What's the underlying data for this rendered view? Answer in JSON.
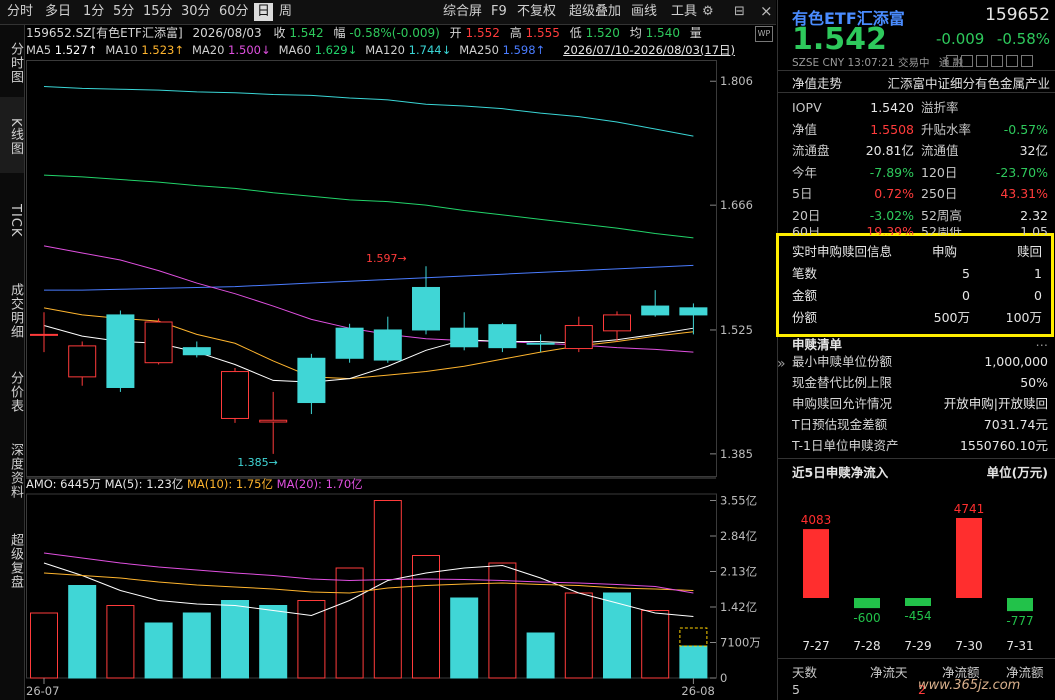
{
  "toolbar": {
    "left": [
      "分时",
      "多日",
      "1分",
      "5分",
      "15分",
      "30分",
      "60分",
      "日",
      "周"
    ],
    "active": "日",
    "right": [
      "综合屏",
      "F9",
      "不复权",
      "超级叠加",
      "画线",
      "工具"
    ]
  },
  "left_tabs": [
    "分时图",
    "K线图",
    "TICK",
    "成交明细",
    "分价表",
    "深度资料",
    "超级复盘"
  ],
  "quote_line": {
    "code": "159652.SZ[有色ETF汇添富]",
    "date": "2026/08/03",
    "close_label": "收",
    "close": "1.542",
    "range_label": "幅",
    "range": "-0.58%(-0.009)",
    "open_label": "开",
    "open": "1.552",
    "high_label": "高",
    "high": "1.555",
    "low_label": "低",
    "low": "1.520",
    "avg_label": "均",
    "avg": "1.540",
    "vol_label": "量"
  },
  "ma_line": {
    "items": [
      {
        "name": "MA5",
        "value": "1.527↑",
        "color": "#ffffff"
      },
      {
        "name": "MA10",
        "value": "1.523↑",
        "color": "#ffb52e"
      },
      {
        "name": "MA20",
        "value": "1.500↓",
        "color": "#e050e0"
      },
      {
        "name": "MA60",
        "value": "1.629↓",
        "color": "#22d36a"
      },
      {
        "name": "MA120",
        "value": "1.744↓",
        "color": "#3ad6d6"
      },
      {
        "name": "MA250",
        "value": "1.598↑",
        "color": "#4a7cff"
      }
    ],
    "range": "2026/07/10-2026/08/03(17日)"
  },
  "chart_data": [
    {
      "type": "candlestick",
      "ylim": [
        1.36,
        1.83
      ],
      "y_ticks": [
        1.806,
        1.666,
        1.525,
        1.385
      ],
      "annotations": [
        {
          "text": "1.597",
          "value": 1.597
        },
        {
          "text": "1.385",
          "value": 1.385
        }
      ],
      "candles": [
        {
          "o": 1.52,
          "c": 1.52,
          "h": 1.545,
          "l": 1.5
        },
        {
          "o": 1.472,
          "c": 1.507,
          "h": 1.512,
          "l": 1.462
        },
        {
          "o": 1.542,
          "c": 1.46,
          "h": 1.547,
          "l": 1.455
        },
        {
          "o": 1.488,
          "c": 1.534,
          "h": 1.538,
          "l": 1.486
        },
        {
          "o": 1.505,
          "c": 1.497,
          "h": 1.512,
          "l": 1.494
        },
        {
          "o": 1.425,
          "c": 1.478,
          "h": 1.482,
          "l": 1.42
        },
        {
          "o": 1.421,
          "c": 1.423,
          "h": 1.455,
          "l": 1.385
        },
        {
          "o": 1.493,
          "c": 1.443,
          "h": 1.498,
          "l": 1.43
        },
        {
          "o": 1.527,
          "c": 1.493,
          "h": 1.532,
          "l": 1.488
        },
        {
          "o": 1.525,
          "c": 1.491,
          "h": 1.54,
          "l": 1.488
        },
        {
          "o": 1.573,
          "c": 1.525,
          "h": 1.597,
          "l": 1.52
        },
        {
          "o": 1.527,
          "c": 1.506,
          "h": 1.545,
          "l": 1.502
        },
        {
          "o": 1.531,
          "c": 1.505,
          "h": 1.533,
          "l": 1.5
        },
        {
          "o": 1.51,
          "c": 1.51,
          "h": 1.52,
          "l": 1.5
        },
        {
          "o": 1.504,
          "c": 1.53,
          "h": 1.54,
          "l": 1.5
        },
        {
          "o": 1.524,
          "c": 1.542,
          "h": 1.546,
          "l": 1.512
        },
        {
          "o": 1.552,
          "c": 1.542,
          "h": 1.57,
          "l": 1.54
        },
        {
          "o": 1.55,
          "c": 1.542,
          "h": 1.555,
          "l": 1.52
        }
      ],
      "ma_series": [
        {
          "name": "MA120",
          "color": "#3ad6d6",
          "values": [
            1.8,
            1.798,
            1.797,
            1.796,
            1.794,
            1.793,
            1.791,
            1.79,
            1.787,
            1.785,
            1.78,
            1.778,
            1.775,
            1.77,
            1.766,
            1.76,
            1.752,
            1.744
          ]
        },
        {
          "name": "MA60",
          "color": "#22d36a",
          "values": [
            1.7,
            1.698,
            1.695,
            1.692,
            1.688,
            1.685,
            1.68,
            1.676,
            1.672,
            1.67,
            1.666,
            1.66,
            1.655,
            1.65,
            1.645,
            1.64,
            1.634,
            1.629
          ]
        },
        {
          "name": "MA250",
          "color": "#4a7cff",
          "values": [
            1.57,
            1.57,
            1.571,
            1.572,
            1.573,
            1.574,
            1.576,
            1.578,
            1.58,
            1.582,
            1.584,
            1.586,
            1.588,
            1.59,
            1.592,
            1.594,
            1.596,
            1.598
          ]
        },
        {
          "name": "MA20",
          "color": "#e050e0",
          "values": [
            1.62,
            1.612,
            1.604,
            1.592,
            1.578,
            1.566,
            1.552,
            1.537,
            1.527,
            1.52,
            1.515,
            1.513,
            1.512,
            1.51,
            1.508,
            1.505,
            1.503,
            1.5
          ]
        },
        {
          "name": "MA10",
          "color": "#ffb52e",
          "values": [
            1.55,
            1.542,
            1.538,
            1.535,
            1.52,
            1.51,
            1.49,
            1.472,
            1.47,
            1.474,
            1.478,
            1.484,
            1.492,
            1.5,
            1.507,
            1.512,
            1.518,
            1.523
          ]
        },
        {
          "name": "MA5",
          "color": "#ffffff",
          "values": [
            1.53,
            1.518,
            1.512,
            1.51,
            1.5,
            1.486,
            1.468,
            1.466,
            1.47,
            1.484,
            1.502,
            1.514,
            1.512,
            1.512,
            1.51,
            1.514,
            1.52,
            1.527
          ]
        }
      ]
    },
    {
      "type": "bar",
      "header": {
        "label": "AMO:",
        "value": "6445万",
        "ma5": "MA(5): 1.23亿",
        "ma10": "MA(10): 1.75亿",
        "ma20": "MA(20): 1.70亿"
      },
      "ylim": [
        0,
        3.6
      ],
      "y_ticks": [
        {
          "v": 3.55,
          "t": "3.55亿"
        },
        {
          "v": 2.84,
          "t": "2.84亿"
        },
        {
          "v": 2.13,
          "t": "2.13亿"
        },
        {
          "v": 1.42,
          "t": "1.42亿"
        },
        {
          "v": 0.71,
          "t": "7100万"
        },
        {
          "v": 0,
          "t": "0"
        }
      ],
      "x_ticks": [
        {
          "i": 0,
          "t": "26-07"
        },
        {
          "i": 17,
          "t": "26-08"
        }
      ],
      "values": [
        1.3,
        1.85,
        1.45,
        1.1,
        1.3,
        1.55,
        1.45,
        1.55,
        2.2,
        3.55,
        2.45,
        1.6,
        2.3,
        0.9,
        1.7,
        1.7,
        1.35,
        0.64
      ],
      "up": [
        false,
        true,
        false,
        true,
        true,
        true,
        true,
        false,
        false,
        false,
        false,
        true,
        false,
        true,
        false,
        true,
        false,
        true
      ],
      "ma_series": [
        {
          "name": "MA(5)",
          "color": "#ffffff",
          "values": [
            2.3,
            2.05,
            1.75,
            1.55,
            1.48,
            1.45,
            1.35,
            1.25,
            1.55,
            1.95,
            2.1,
            2.2,
            2.25,
            2.0,
            1.7,
            1.5,
            1.3,
            1.23
          ]
        },
        {
          "name": "MA(10)",
          "color": "#ffb52e",
          "values": [
            2.1,
            2.05,
            2.0,
            1.92,
            1.86,
            1.82,
            1.78,
            1.72,
            1.7,
            1.8,
            1.85,
            1.88,
            1.9,
            1.87,
            1.85,
            1.8,
            1.78,
            1.75
          ]
        },
        {
          "name": "MA(20)",
          "color": "#e050e0",
          "values": [
            2.5,
            2.4,
            2.3,
            2.22,
            2.16,
            2.1,
            2.05,
            1.98,
            1.95,
            1.97,
            1.98,
            1.97,
            1.95,
            1.92,
            1.9,
            1.87,
            1.83,
            1.7
          ]
        }
      ]
    },
    {
      "type": "bar",
      "title": "近5日申赎净流入",
      "unit": "单位(万元)",
      "categories": [
        "7-27",
        "7-28",
        "7-29",
        "7-30",
        "7-31"
      ],
      "values": [
        4083,
        -600,
        -454,
        4741,
        -777
      ]
    }
  ],
  "right": {
    "name": "有色ETF汇添富",
    "code": "159652",
    "price": "1.542",
    "change": "-0.009",
    "change_pct": "-0.58%",
    "market": "SZSE",
    "currency": "CNY",
    "time": "13:07:21",
    "trade_label": "交易中",
    "tong_label": "通",
    "rong_label": "融",
    "nav_tab": "净值走势",
    "index_name": "汇添富中证细分有色金属产业",
    "rows": [
      {
        "l": "IOPV",
        "lv": "1.5420",
        "lc": "white",
        "r": "溢折率",
        "rv": "",
        "rc": "white"
      },
      {
        "l": "净值",
        "lv": "1.5508",
        "lc": "red",
        "r": "升贴水率",
        "rv": "-0.57%",
        "rc": "green"
      },
      {
        "l": "流通盘",
        "lv": "20.81亿",
        "lc": "white",
        "r": "流通值",
        "rv": "32亿",
        "rc": "white"
      },
      {
        "l": "今年",
        "lv": "-7.89%",
        "lc": "green",
        "r": "120日",
        "rv": "-23.70%",
        "rc": "green"
      },
      {
        "l": "5日",
        "lv": "0.72%",
        "lc": "red",
        "r": "250日",
        "rv": "43.31%",
        "rc": "red"
      },
      {
        "l": "20日",
        "lv": "-3.02%",
        "lc": "green",
        "r": "52周高",
        "rv": "2.32",
        "rc": "white"
      }
    ],
    "partial_row": {
      "l": "60日",
      "lv": "19.39%",
      "r": "52周低",
      "rv": "1.05"
    },
    "sub": {
      "title": "实时申购赎回信息",
      "col1": "申购",
      "col2": "赎回",
      "rows": [
        {
          "l": "笔数",
          "a": "5",
          "b": "1"
        },
        {
          "l": "金额",
          "a": "0",
          "b": "0"
        },
        {
          "l": "份额",
          "a": "500万",
          "b": "100万"
        }
      ]
    },
    "list_title": "申赎清单",
    "list_more": "…",
    "list": [
      {
        "l": "最小申赎单位份额",
        "r": "1,000,000"
      },
      {
        "l": "现金替代比例上限",
        "r": "50%"
      },
      {
        "l": "申购赎回允许情况",
        "r": "开放申购|开放赎回"
      },
      {
        "l": "T日预估现金差额",
        "r": "7031.74元"
      },
      {
        "l": "T-1日单位申赎资产",
        "r": "1550760.10元"
      }
    ],
    "bottom": {
      "h1": "天数",
      "h2": "净流天",
      "h3": "净流额",
      "h4": "净流额",
      "v1": "5",
      "v2": "2",
      "v3": "",
      "v4": ""
    },
    "watermark": "www.365jz.com",
    "collapse_glyph": "»",
    "close_glyph": "×"
  }
}
